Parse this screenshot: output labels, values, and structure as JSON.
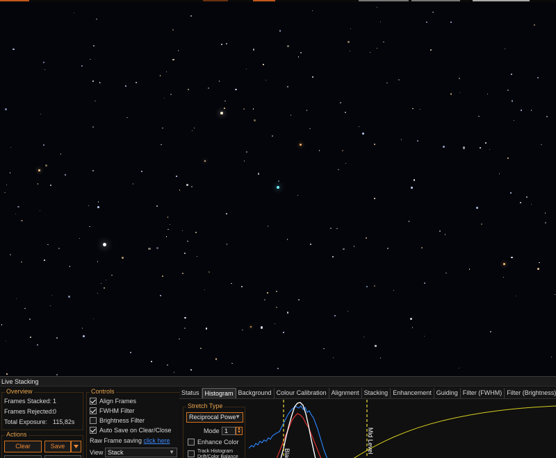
{
  "colors": {
    "accent": "#f08a35",
    "group_title": "#e8a24a",
    "link": "#3d8cff",
    "sky": "#04050a",
    "histogram_blue": "#2a7ff0",
    "histogram_red": "#e03030",
    "histogram_white": "#ffffff",
    "curve_yellow": "#d8d020",
    "marker_yellow": "#f0e040"
  },
  "panel": {
    "title": "Live Stacking"
  },
  "overview": {
    "title": "Overview",
    "frames_stacked_label": "Frames Stacked:",
    "frames_stacked_value": "1",
    "frames_rejected_label": "Frames Rejected:",
    "frames_rejected_value": "0",
    "total_exposure_label": "Total Exposure:",
    "total_exposure_value": "115,82s"
  },
  "actions": {
    "title": "Actions",
    "clear_label": "Clear",
    "save_label": "Save",
    "save_dropdown_icon": "chevron-down-icon"
  },
  "controls": {
    "title": "Controls",
    "align_frames": {
      "label": "Align Frames",
      "checked": true
    },
    "fwhm_filter": {
      "label": "FWHM Filter",
      "checked": true
    },
    "brightness_filter": {
      "label": "Brightness Filter",
      "checked": false
    },
    "auto_save": {
      "label": "Auto Save on Clear/Close",
      "checked": true
    },
    "raw_frame_label": "Raw Frame saving",
    "raw_frame_link": "click here",
    "view_label": "View",
    "view_value": "Stack"
  },
  "tabs": [
    {
      "label": "Status",
      "active": false
    },
    {
      "label": "Histogram",
      "active": true
    },
    {
      "label": "Background",
      "active": false
    },
    {
      "label": "Colour Calibration",
      "active": false
    },
    {
      "label": "Alignment",
      "active": false
    },
    {
      "label": "Stacking",
      "active": false
    },
    {
      "label": "Enhancement",
      "active": false
    },
    {
      "label": "Guiding",
      "active": false
    },
    {
      "label": "Filter (FWHM)",
      "active": false
    },
    {
      "label": "Filter (Brightness)",
      "active": false
    }
  ],
  "histogram": {
    "stretch_type_title": "Stretch Type",
    "stretch_type_value": "Reciprocal Powe",
    "mode_label": "Mode",
    "mode_value": "1",
    "enhance_color": {
      "label": "Enhance Color",
      "checked": false
    },
    "track_histogram": {
      "label": "Track Histogram Drift/Color Balance",
      "checked": false
    },
    "black_marker_label": "Black",
    "mid_marker_label": "Mid Level"
  }
}
